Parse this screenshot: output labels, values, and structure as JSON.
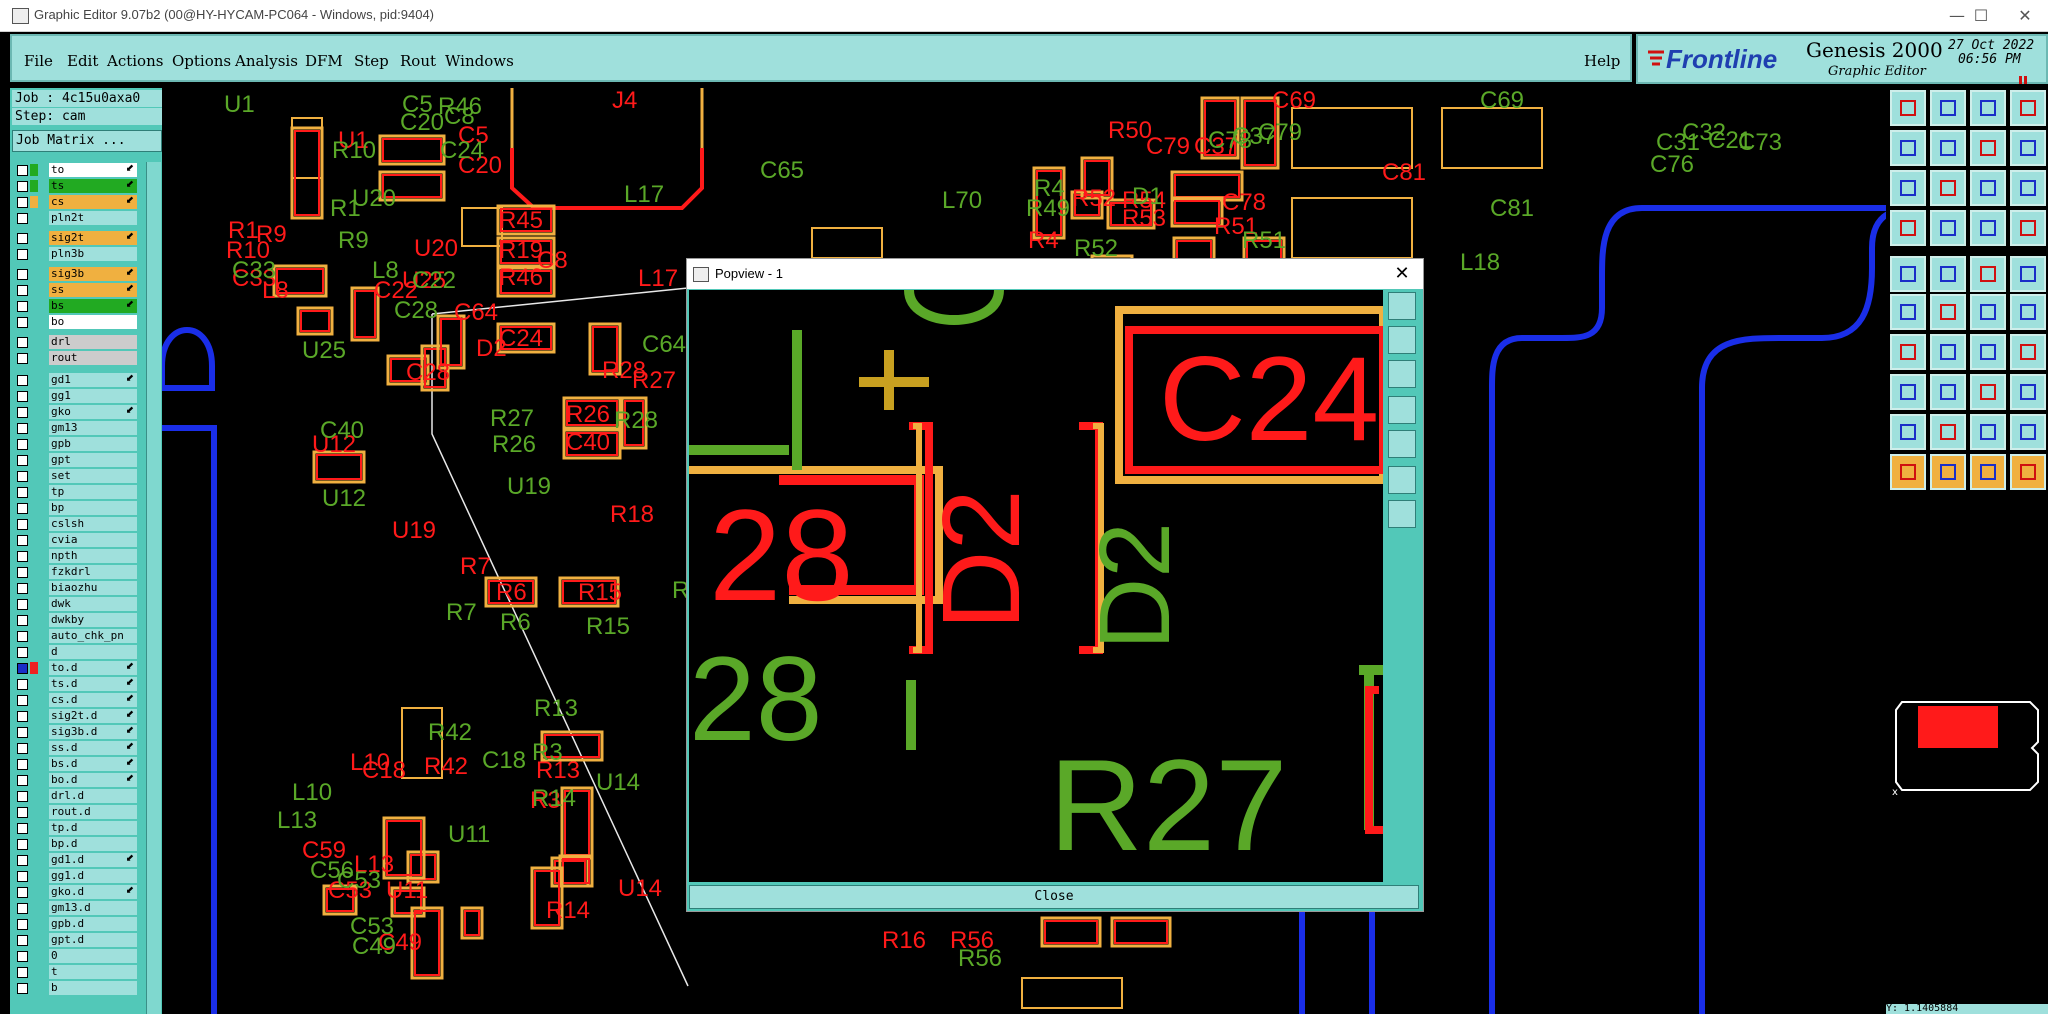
{
  "window": {
    "title": "Graphic Editor 9.07b2 (00@HY-HYCAM-PC064 - Windows, pid:9404)",
    "min": "—",
    "max": "☐",
    "close": "✕"
  },
  "menu": {
    "items": [
      "File",
      "Edit",
      "Actions",
      "Options",
      "Analysis",
      "DFM",
      "Step",
      "Rout",
      "Windows"
    ],
    "help": "Help"
  },
  "brand": {
    "logo": "Frontline",
    "product": "Genesis 2000",
    "subtitle": "Graphic Editor",
    "date": "27 Oct 2022",
    "time": "06:56 PM"
  },
  "left": {
    "job": "Job : 4c15u0axa0",
    "step": "Step: cam",
    "matrix": "Job Matrix ...",
    "layers": [
      {
        "name": "to",
        "bg": "#ffffff",
        "sw": "#22aa22",
        "arrow": true
      },
      {
        "name": "ts",
        "bg": "#22aa22",
        "sw": "#22aa22",
        "arrow": true
      },
      {
        "name": "cs",
        "bg": "#f0b040",
        "sw": "#f0b040",
        "arrow": true
      },
      {
        "name": "pln2t",
        "bg": "#9fe0dc",
        "sw": "",
        "arrow": false
      },
      {
        "name": "sig2t",
        "bg": "#f0b040",
        "sw": "",
        "arrow": true
      },
      {
        "name": "pln3b",
        "bg": "#9fe0dc",
        "sw": "",
        "arrow": false
      },
      {
        "name": "sig3b",
        "bg": "#f0b040",
        "sw": "",
        "arrow": true
      },
      {
        "name": "ss",
        "bg": "#f0b040",
        "sw": "",
        "arrow": true
      },
      {
        "name": "bs",
        "bg": "#22aa22",
        "sw": "",
        "arrow": true
      },
      {
        "name": "bo",
        "bg": "#ffffff",
        "sw": "",
        "arrow": false
      },
      {
        "name": "drl",
        "bg": "#cccccc",
        "sw": "",
        "arrow": false
      },
      {
        "name": "rout",
        "bg": "#cccccc",
        "sw": "",
        "arrow": false
      },
      {
        "name": "gd1",
        "bg": "#9fe0dc",
        "sw": "",
        "arrow": true
      },
      {
        "name": "gg1",
        "bg": "#9fe0dc",
        "sw": "",
        "arrow": false
      },
      {
        "name": "gko",
        "bg": "#9fe0dc",
        "sw": "",
        "arrow": true
      },
      {
        "name": "gm13",
        "bg": "#9fe0dc",
        "sw": "",
        "arrow": false
      },
      {
        "name": "gpb",
        "bg": "#9fe0dc",
        "sw": "",
        "arrow": false
      },
      {
        "name": "gpt",
        "bg": "#9fe0dc",
        "sw": "",
        "arrow": false
      },
      {
        "name": "set",
        "bg": "#9fe0dc",
        "sw": "",
        "arrow": false
      },
      {
        "name": "tp",
        "bg": "#9fe0dc",
        "sw": "",
        "arrow": false
      },
      {
        "name": "bp",
        "bg": "#9fe0dc",
        "sw": "",
        "arrow": false
      },
      {
        "name": "cslsh",
        "bg": "#9fe0dc",
        "sw": "",
        "arrow": false
      },
      {
        "name": "cvia",
        "bg": "#9fe0dc",
        "sw": "",
        "arrow": false
      },
      {
        "name": "npth",
        "bg": "#9fe0dc",
        "sw": "",
        "arrow": false
      },
      {
        "name": "fzkdrl",
        "bg": "#9fe0dc",
        "sw": "",
        "arrow": false
      },
      {
        "name": "biaozhu",
        "bg": "#9fe0dc",
        "sw": "",
        "arrow": false
      },
      {
        "name": "dwk",
        "bg": "#9fe0dc",
        "sw": "",
        "arrow": false
      },
      {
        "name": "dwkby",
        "bg": "#9fe0dc",
        "sw": "",
        "arrow": false
      },
      {
        "name": "auto_chk_pn",
        "bg": "#9fe0dc",
        "sw": "",
        "arrow": false
      },
      {
        "name": "d",
        "bg": "#9fe0dc",
        "sw": "",
        "arrow": false
      },
      {
        "name": "to.d",
        "bg": "#9fe0dc",
        "sw": "#ee2222",
        "arrow": true
      },
      {
        "name": "ts.d",
        "bg": "#9fe0dc",
        "sw": "",
        "arrow": true
      },
      {
        "name": "cs.d",
        "bg": "#9fe0dc",
        "sw": "",
        "arrow": true
      },
      {
        "name": "sig2t.d",
        "bg": "#9fe0dc",
        "sw": "",
        "arrow": true
      },
      {
        "name": "sig3b.d",
        "bg": "#9fe0dc",
        "sw": "",
        "arrow": true
      },
      {
        "name": "ss.d",
        "bg": "#9fe0dc",
        "sw": "",
        "arrow": true
      },
      {
        "name": "bs.d",
        "bg": "#9fe0dc",
        "sw": "",
        "arrow": true
      },
      {
        "name": "bo.d",
        "bg": "#9fe0dc",
        "sw": "",
        "arrow": true
      },
      {
        "name": "drl.d",
        "bg": "#9fe0dc",
        "sw": "",
        "arrow": false
      },
      {
        "name": "rout.d",
        "bg": "#9fe0dc",
        "sw": "",
        "arrow": false
      },
      {
        "name": "tp.d",
        "bg": "#9fe0dc",
        "sw": "",
        "arrow": false
      },
      {
        "name": "bp.d",
        "bg": "#9fe0dc",
        "sw": "",
        "arrow": false
      },
      {
        "name": "gd1.d",
        "bg": "#9fe0dc",
        "sw": "",
        "arrow": true
      },
      {
        "name": "gg1.d",
        "bg": "#9fe0dc",
        "sw": "",
        "arrow": false
      },
      {
        "name": "gko.d",
        "bg": "#9fe0dc",
        "sw": "",
        "arrow": true
      },
      {
        "name": "gm13.d",
        "bg": "#9fe0dc",
        "sw": "",
        "arrow": false
      },
      {
        "name": "gpb.d",
        "bg": "#9fe0dc",
        "sw": "",
        "arrow": false
      },
      {
        "name": "gpt.d",
        "bg": "#9fe0dc",
        "sw": "",
        "arrow": false
      },
      {
        "name": "0",
        "bg": "#9fe0dc",
        "sw": "",
        "arrow": false
      },
      {
        "name": "t",
        "bg": "#9fe0dc",
        "sw": "",
        "arrow": false
      },
      {
        "name": "b",
        "bg": "#9fe0dc",
        "sw": "",
        "arrow": false
      }
    ]
  },
  "popview": {
    "title": "Popview - 1",
    "close_x": "✕",
    "close_button": "Close",
    "labels": [
      "C24",
      "28",
      "D2",
      "R27"
    ]
  },
  "canvas": {
    "labels_red": [
      "J4",
      "C69",
      "R10",
      "U1",
      "C5",
      "C20",
      "R45",
      "R19",
      "R46",
      "C8",
      "C24",
      "L17",
      "U20",
      "R1",
      "R9",
      "C33",
      "L8",
      "C22",
      "U25",
      "C28",
      "D2",
      "C64",
      "R28",
      "R27",
      "R26",
      "C40",
      "U12",
      "U19",
      "R18",
      "R7",
      "R6",
      "R15",
      "L10",
      "C18",
      "R42",
      "L13",
      "R13",
      "R3",
      "U14",
      "R14",
      "C59",
      "C53",
      "U11",
      "C49",
      "R16",
      "R56",
      "C81",
      "R50",
      "C79",
      "C37",
      "R54",
      "R53",
      "C78",
      "R51",
      "R52",
      "R4"
    ],
    "labels_green": [
      "U1",
      "R10",
      "C5",
      "C20",
      "C8",
      "R46",
      "C24",
      "L17",
      "U20",
      "R1",
      "R9",
      "C33",
      "L8",
      "C22",
      "U25",
      "C28",
      "R28",
      "C64",
      "R27",
      "R26",
      "C40",
      "U12",
      "U19",
      "R18",
      "R7",
      "R6",
      "R15",
      "L10",
      "R42",
      "C18",
      "L13",
      "R13",
      "R3",
      "U14",
      "R14",
      "C56",
      "C53",
      "U11",
      "C53",
      "C49",
      "R56",
      "C65",
      "L70",
      "R49",
      "R4",
      "R52",
      "D1",
      "R51",
      "C69",
      "C81",
      "L18",
      "C76",
      "C31",
      "C32",
      "C21",
      "C73",
      "C78",
      "C37",
      "C79"
    ]
  },
  "statusbar": {
    "text": "Y: 1.1405884"
  }
}
